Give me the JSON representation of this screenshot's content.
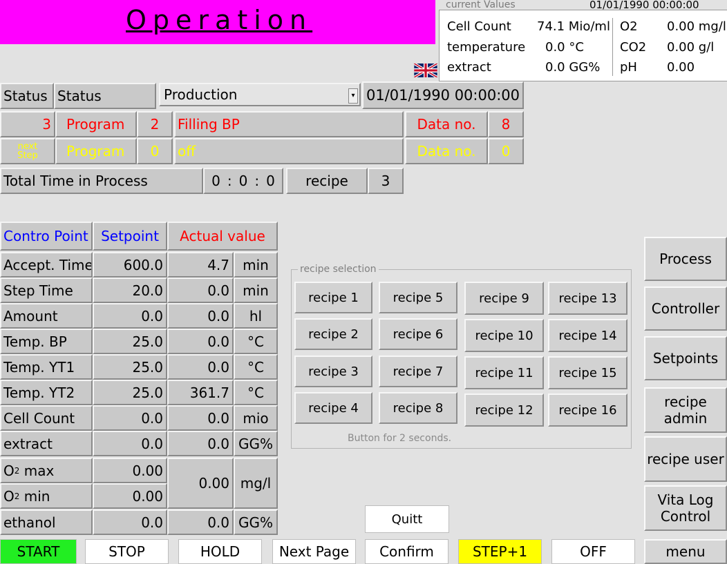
{
  "header": {
    "title": "Operation"
  },
  "current_values": {
    "label": "current Values",
    "datetime": "01/01/1990 00:00:00",
    "cell_count_label": "Cell Count",
    "cell_count_value": "74.1 Mio/ml",
    "temperature_label": "temperature",
    "temperature_value": "0.0 °C",
    "extract_label": "extract",
    "extract_value": "0.0 GG%",
    "o2_label": "O2",
    "o2_value": "0.00 mg/l",
    "co2_label": "CO2",
    "co2_value": "0.00 g/l",
    "ph_label": "pH",
    "ph_value": "0.00"
  },
  "status_row": {
    "status_label1": "Status",
    "status_label2": "Status",
    "mode_selected": "Production",
    "datetime": "01/01/1990 00:00:00"
  },
  "current_step": {
    "step": "3",
    "program_label": "Program",
    "program_no": "2",
    "program_name": "Filling BP",
    "data_label": "Data no.",
    "data_no": "8"
  },
  "next_step": {
    "step_label": "next Step",
    "program_label": "Program",
    "program_no": "0",
    "program_name": "off",
    "data_label": "Data no.",
    "data_no": "0"
  },
  "process_time": {
    "label": "Total Time in Process",
    "h": "0",
    "m": "0",
    "s": "0",
    "sep": ":",
    "recipe_label": "recipe",
    "recipe_no": "3"
  },
  "control_table": {
    "headers": {
      "point": "Contro Point",
      "setpoint": "Setpoint",
      "actual": "Actual value"
    },
    "rows": [
      {
        "name": "Accept. Time",
        "setpoint": "600.0",
        "actual": "4.7",
        "unit": "min"
      },
      {
        "name": "Step Time",
        "setpoint": "20.0",
        "actual": "0.0",
        "unit": "min"
      },
      {
        "name": "Amount",
        "setpoint": "0.0",
        "actual": "0.0",
        "unit": "hl"
      },
      {
        "name": "Temp. BP",
        "setpoint": "25.0",
        "actual": "0.0",
        "unit": "°C"
      },
      {
        "name": "Temp. YT1",
        "setpoint": "25.0",
        "actual": "0.0",
        "unit": "°C"
      },
      {
        "name": "Temp. YT2",
        "setpoint": "25.0",
        "actual": "361.7",
        "unit": "°C"
      },
      {
        "name": "Cell Count",
        "setpoint": "0.0",
        "actual": "0.0",
        "unit": "mio"
      },
      {
        "name": "extract",
        "setpoint": "0.0",
        "actual": "0.0",
        "unit": "GG%"
      }
    ],
    "o2": {
      "max_prefix": "O",
      "max_sub": "2",
      "max_suffix": " max",
      "max_setpoint": "0.00",
      "min_prefix": "O",
      "min_sub": "2",
      "min_suffix": " min",
      "min_setpoint": "0.00",
      "actual": "0.00",
      "unit": "mg/l"
    },
    "ethanol": {
      "name": "ethanol",
      "setpoint": "0.0",
      "actual": "0.0",
      "unit": "GG%"
    }
  },
  "recipe_selection": {
    "legend": "recipe selection",
    "hint": "Button for 2 seconds.",
    "buttons": [
      "recipe 1",
      "recipe 2",
      "recipe 3",
      "recipe 4",
      "recipe 5",
      "recipe 6",
      "recipe 7",
      "recipe 8",
      "recipe 9",
      "recipe 10",
      "recipe 11",
      "recipe 12",
      "recipe 13",
      "recipe 14",
      "recipe 15",
      "recipe 16"
    ]
  },
  "side_nav": {
    "process": "Process",
    "controller": "Controller",
    "setpoints": "Setpoints",
    "recipe_admin": "recipe admin",
    "recipe_user": "recipe user",
    "vita_log": "Vita Log Control",
    "menu": "menu"
  },
  "quit_label": "Quitt",
  "bottom_bar": {
    "start": "START",
    "stop": "STOP",
    "hold": "HOLD",
    "next_page": "Next Page",
    "confirm": "Confirm",
    "step_plus": "STEP+1",
    "off": "OFF"
  },
  "colors": {
    "header_bg": "#ff00ff",
    "start_bg": "#22ee22",
    "step_bg": "#ffff00",
    "red_text": "#ff0000",
    "yellow_text": "#ffff00",
    "blue_text": "#0000ff"
  }
}
